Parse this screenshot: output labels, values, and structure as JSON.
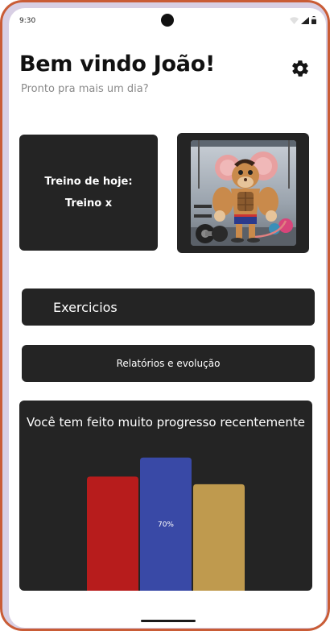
{
  "status_bar": {
    "time": "9:30",
    "icons": [
      "wifi-icon",
      "signal-icon",
      "battery-icon"
    ]
  },
  "header": {
    "title": "Bem vindo João!",
    "subtitle": "Pronto pra mais um dia?",
    "settings_icon": "gear-icon"
  },
  "today": {
    "label": "Treino de hoje:",
    "workout": "Treino x"
  },
  "avatar": {
    "icon": "muscular-mouse-gym-illustration"
  },
  "buttons": {
    "exercises": "Exercicios",
    "reports": "Relatórios e evolução"
  },
  "progress": {
    "title": "Você tem feito muito progresso recentemente"
  },
  "chart_data": {
    "type": "bar",
    "title": "Você tem feito muito progresso recentemente",
    "categories": [
      "",
      "",
      ""
    ],
    "values": [
      60,
      70,
      56
    ],
    "data_labels": [
      "",
      "70%",
      ""
    ],
    "colors": [
      "#b71c1c",
      "#3949a6",
      "#bf9a4e"
    ],
    "ylim": [
      0,
      100
    ],
    "grid": false
  },
  "colors": {
    "card": "#242424",
    "frame": "#c95c36",
    "accent_blue": "#3949a6"
  }
}
